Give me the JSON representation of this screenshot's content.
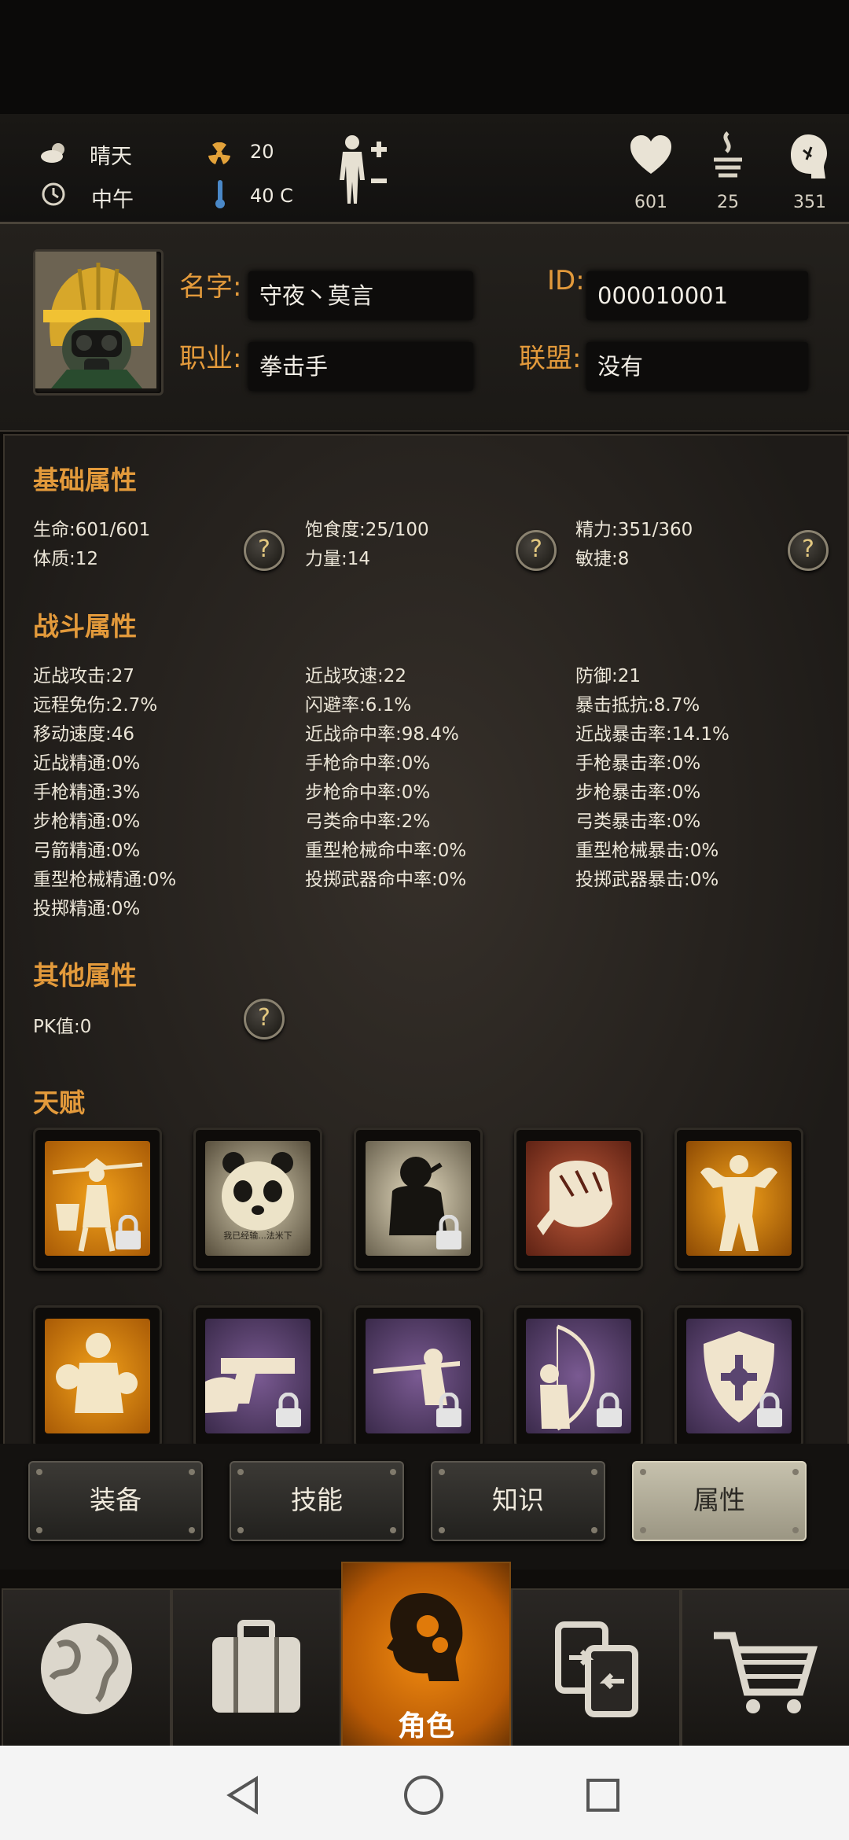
{
  "header": {
    "weather": "晴天",
    "time_of_day": "中午",
    "radiation": "20",
    "temperature": "40 C",
    "health": "601",
    "hunger": "25",
    "mind": "351"
  },
  "profile": {
    "name_label": "名字:",
    "name_value": "守夜丶莫言",
    "id_label": "ID:",
    "id_value": "000010001",
    "job_label": "职业:",
    "job_value": "拳击手",
    "alliance_label": "联盟:",
    "alliance_value": "没有"
  },
  "basic": {
    "title": "基础属性",
    "items": [
      "生命:601/601",
      "饱食度:25/100",
      "精力:351/360",
      "体质:12",
      "力量:14",
      "敏捷:8"
    ]
  },
  "combat": {
    "title": "战斗属性",
    "col1": [
      "近战攻击:27",
      "远程免伤:2.7%",
      "移动速度:46",
      "近战精通:0%",
      "手枪精通:3%",
      "步枪精通:0%",
      "弓箭精通:0%",
      "重型枪械精通:0%",
      "投掷精通:0%"
    ],
    "col2": [
      "近战攻速:22",
      "闪避率:6.1%",
      "近战命中率:98.4%",
      "手枪命中率:0%",
      "步枪命中率:0%",
      "弓类命中率:2%",
      "重型枪械命中率:0%",
      "投掷武器命中率:0%"
    ],
    "col3": [
      "防御:21",
      "暴击抵抗:8.7%",
      "近战暴击率:14.1%",
      "手枪暴击率:0%",
      "步枪暴击率:0%",
      "弓类暴击率:0%",
      "重型枪械暴击:0%",
      "投掷武器暴击:0%"
    ]
  },
  "other": {
    "title": "其他属性",
    "pk": "PK值:0"
  },
  "talent": {
    "title": "天赋",
    "panda_caption": "我已经输...法米下",
    "icons": [
      "porter-icon",
      "panda-icon",
      "thinker-icon",
      "fist-icon",
      "muscle-icon",
      "boxer-icon",
      "pistol-icon",
      "rifle-icon",
      "bow-icon",
      "shield-icon"
    ]
  },
  "tabs": {
    "equip": "装备",
    "skill": "技能",
    "knowledge": "知识",
    "attributes": "属性"
  },
  "nav": {
    "character": "角色"
  },
  "colors": {
    "accent": "#e39a3b",
    "active_nav": "#e07a0a"
  }
}
